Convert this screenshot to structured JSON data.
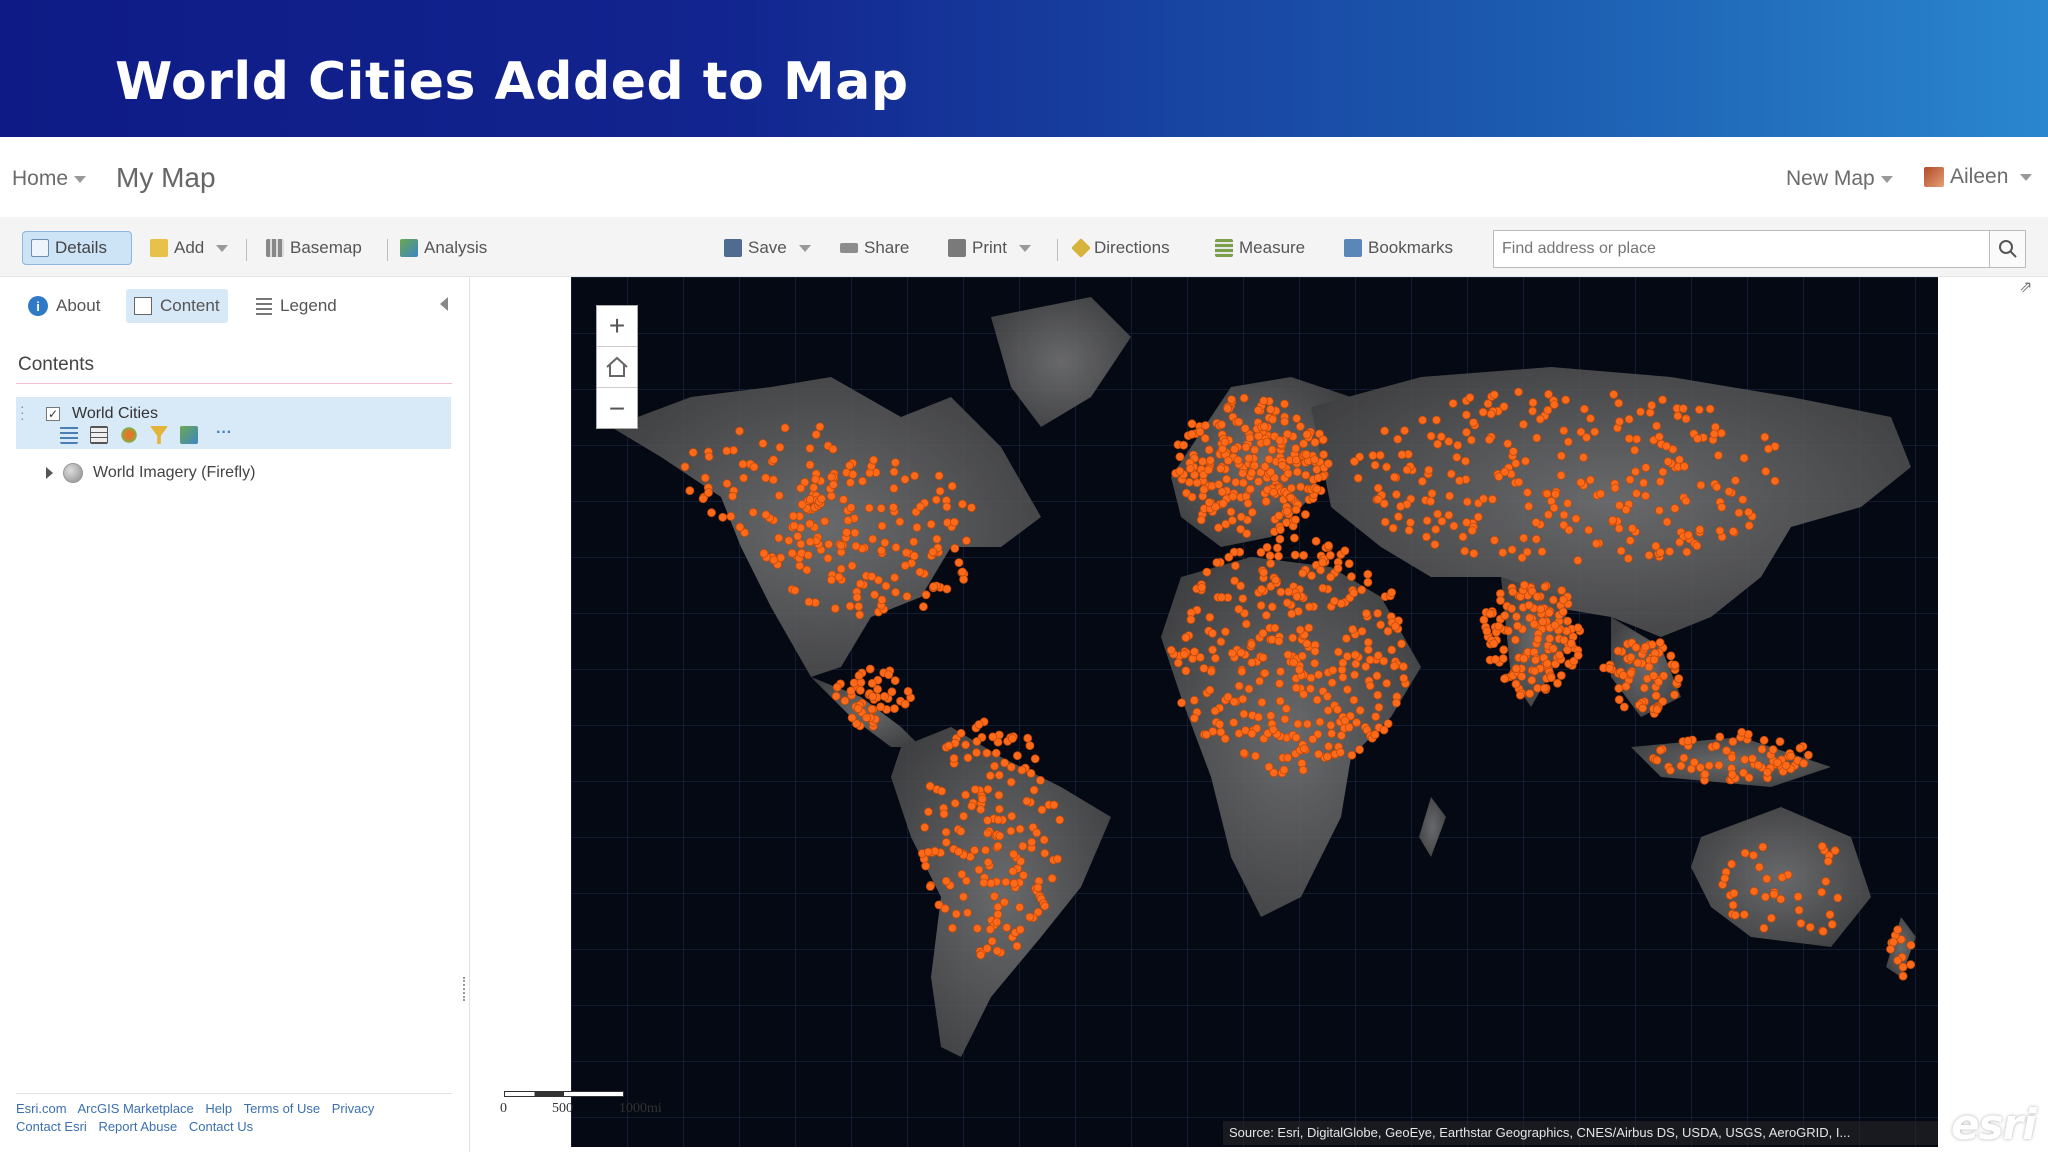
{
  "slide": {
    "title": "World Cities Added to Map"
  },
  "header": {
    "home": "Home",
    "map_title": "My Map",
    "new_map": "New Map",
    "user": "Aileen"
  },
  "toolbar": {
    "details": "Details",
    "add": "Add",
    "basemap": "Basemap",
    "analysis": "Analysis",
    "save": "Save",
    "share": "Share",
    "print": "Print",
    "directions": "Directions",
    "measure": "Measure",
    "bookmarks": "Bookmarks",
    "search_placeholder": "Find address or place"
  },
  "panel": {
    "tabs": {
      "about": "About",
      "content": "Content",
      "legend": "Legend"
    },
    "contents_title": "Contents",
    "layers": [
      {
        "name": "World Cities",
        "checked": true
      },
      {
        "name": "World Imagery (Firefly)"
      }
    ],
    "footer_links_row1": [
      "Esri.com",
      "ArcGIS Marketplace",
      "Help",
      "Terms of Use",
      "Privacy"
    ],
    "footer_links_row2": [
      "Contact Esri",
      "Report Abuse",
      "Contact Us"
    ]
  },
  "map": {
    "scale_labels": [
      "0",
      "500",
      "1000mi"
    ],
    "attribution": "Source: Esri, DigitalGlobe, GeoEye, Earthstar Geographics, CNES/Airbus DS, USDA, USGS, AeroGRID, I...",
    "logo": "esri",
    "point_color": "#ff6a1a",
    "background_color": "#050914"
  }
}
